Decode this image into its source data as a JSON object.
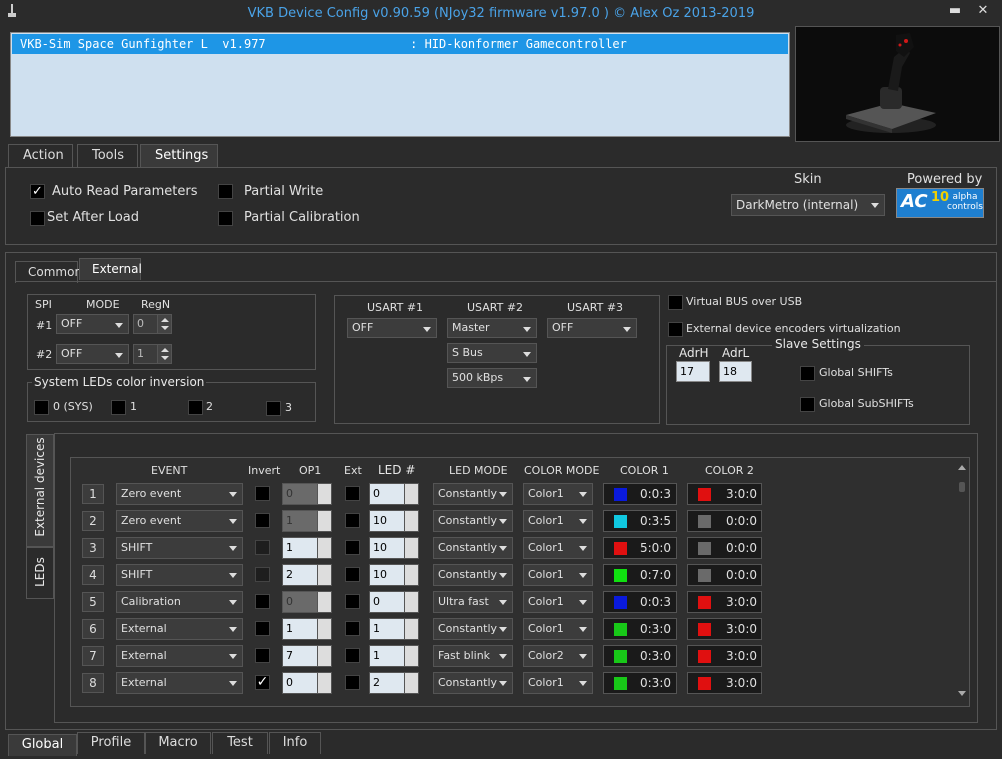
{
  "window": {
    "title": "VKB Device Config v0.90.59 (NJoy32 firmware v1.97.0  ) © Alex Oz 2013-2019",
    "minimize_glyph": "▬",
    "close_glyph": "✕"
  },
  "device_list": {
    "selected_row": "VKB-Sim Space Gunfighter L  v1.977                    : HID-konformer Gamecontroller"
  },
  "main_tabs": [
    "Action",
    "Tools",
    "Settings"
  ],
  "settings": {
    "auto_read": {
      "label": "Auto Read Parameters",
      "checked": "✓"
    },
    "set_after_load": {
      "label": "Set After Load"
    },
    "partial_write": {
      "label": "Partial Write"
    },
    "partial_calibration": {
      "label": "Partial Calibration"
    },
    "skin_label": "Skin",
    "skin_value": "DarkMetro (internal)",
    "powered_by": "Powered by",
    "logo_text": "alpha controls",
    "logo_num": "10"
  },
  "sub_tabs": [
    "Common",
    "External"
  ],
  "spi": {
    "headers": [
      "SPI",
      "MODE",
      "RegN"
    ],
    "rows": [
      {
        "label": "#1",
        "mode": "OFF",
        "regn": "0"
      },
      {
        "label": "#2",
        "mode": "OFF",
        "regn": "1"
      }
    ]
  },
  "leds_inversion": {
    "title": "System LEDs color inversion",
    "items": [
      "0 (SYS)",
      "1",
      "2",
      "3"
    ]
  },
  "usart": {
    "headers": [
      "USART #1",
      "USART #2",
      "USART #3"
    ],
    "u1": "OFF",
    "u2": "Master",
    "u2_bus": "S Bus",
    "u2_speed": "500 kBps",
    "u3": "OFF"
  },
  "virtual_bus": "Virtual BUS over USB",
  "ext_encoders": "External device encoders virtualization",
  "slave": {
    "title": "Slave Settings",
    "adrh_label": "AdrH",
    "adrh": "17",
    "adrl_label": "AdrL",
    "adrl": "18",
    "global_shifts": "Global SHIFTs",
    "global_subshifts": "Global SubSHIFTs"
  },
  "side_tabs": [
    "External devices",
    "LEDs"
  ],
  "led_table": {
    "headers": [
      "EVENT",
      "Invert",
      "OP1",
      "Ext",
      "LED #",
      "LED MODE",
      "COLOR MODE",
      "COLOR 1",
      "COLOR 2"
    ],
    "rows": [
      {
        "n": "1",
        "event": "Zero event",
        "invert": "",
        "op1": "0",
        "led": "0",
        "mode": "Constantly",
        "cmode": "Color1",
        "c1": "0:0:3",
        "c1col": "#0a1adc",
        "c2": "3:0:0",
        "c2col": "#e01010"
      },
      {
        "n": "2",
        "event": "Zero event",
        "invert": "",
        "op1": "1",
        "led": "10",
        "mode": "Constantly",
        "cmode": "Color1",
        "c1": "0:3:5",
        "c1col": "#10c8e0",
        "c2": "0:0:0",
        "c2col": "#6a6a6a"
      },
      {
        "n": "3",
        "event": "SHIFT",
        "invert": "",
        "op1": "1",
        "led": "10",
        "mode": "Constantly",
        "cmode": "Color1",
        "c1": "5:0:0",
        "c1col": "#e01010",
        "c2": "0:0:0",
        "c2col": "#6a6a6a"
      },
      {
        "n": "4",
        "event": "SHIFT",
        "invert": "",
        "op1": "2",
        "led": "10",
        "mode": "Constantly",
        "cmode": "Color1",
        "c1": "0:7:0",
        "c1col": "#10e010",
        "c2": "0:0:0",
        "c2col": "#6a6a6a"
      },
      {
        "n": "5",
        "event": "Calibration",
        "invert": "",
        "op1": "0",
        "led": "0",
        "mode": "Ultra fast",
        "cmode": "Color1",
        "c1": "0:0:3",
        "c1col": "#0a1adc",
        "c2": "3:0:0",
        "c2col": "#e01010"
      },
      {
        "n": "6",
        "event": "External",
        "invert": "",
        "op1": "1",
        "led": "1",
        "mode": "Constantly",
        "cmode": "Color1",
        "c1": "0:3:0",
        "c1col": "#18c818",
        "c2": "3:0:0",
        "c2col": "#e01010"
      },
      {
        "n": "7",
        "event": "External",
        "invert": "",
        "op1": "7",
        "led": "1",
        "mode": "Fast blink",
        "cmode": "Color2",
        "c1": "0:3:0",
        "c1col": "#18c818",
        "c2": "3:0:0",
        "c2col": "#e01010"
      },
      {
        "n": "8",
        "event": "External",
        "invert": "✓",
        "op1": "0",
        "led": "2",
        "mode": "Constantly",
        "cmode": "Color1",
        "c1": "0:3:0",
        "c1col": "#18c818",
        "c2": "3:0:0",
        "c2col": "#e01010"
      }
    ]
  },
  "bottom_tabs": [
    "Global",
    "Profile",
    "Macro",
    "Test",
    "Info"
  ]
}
